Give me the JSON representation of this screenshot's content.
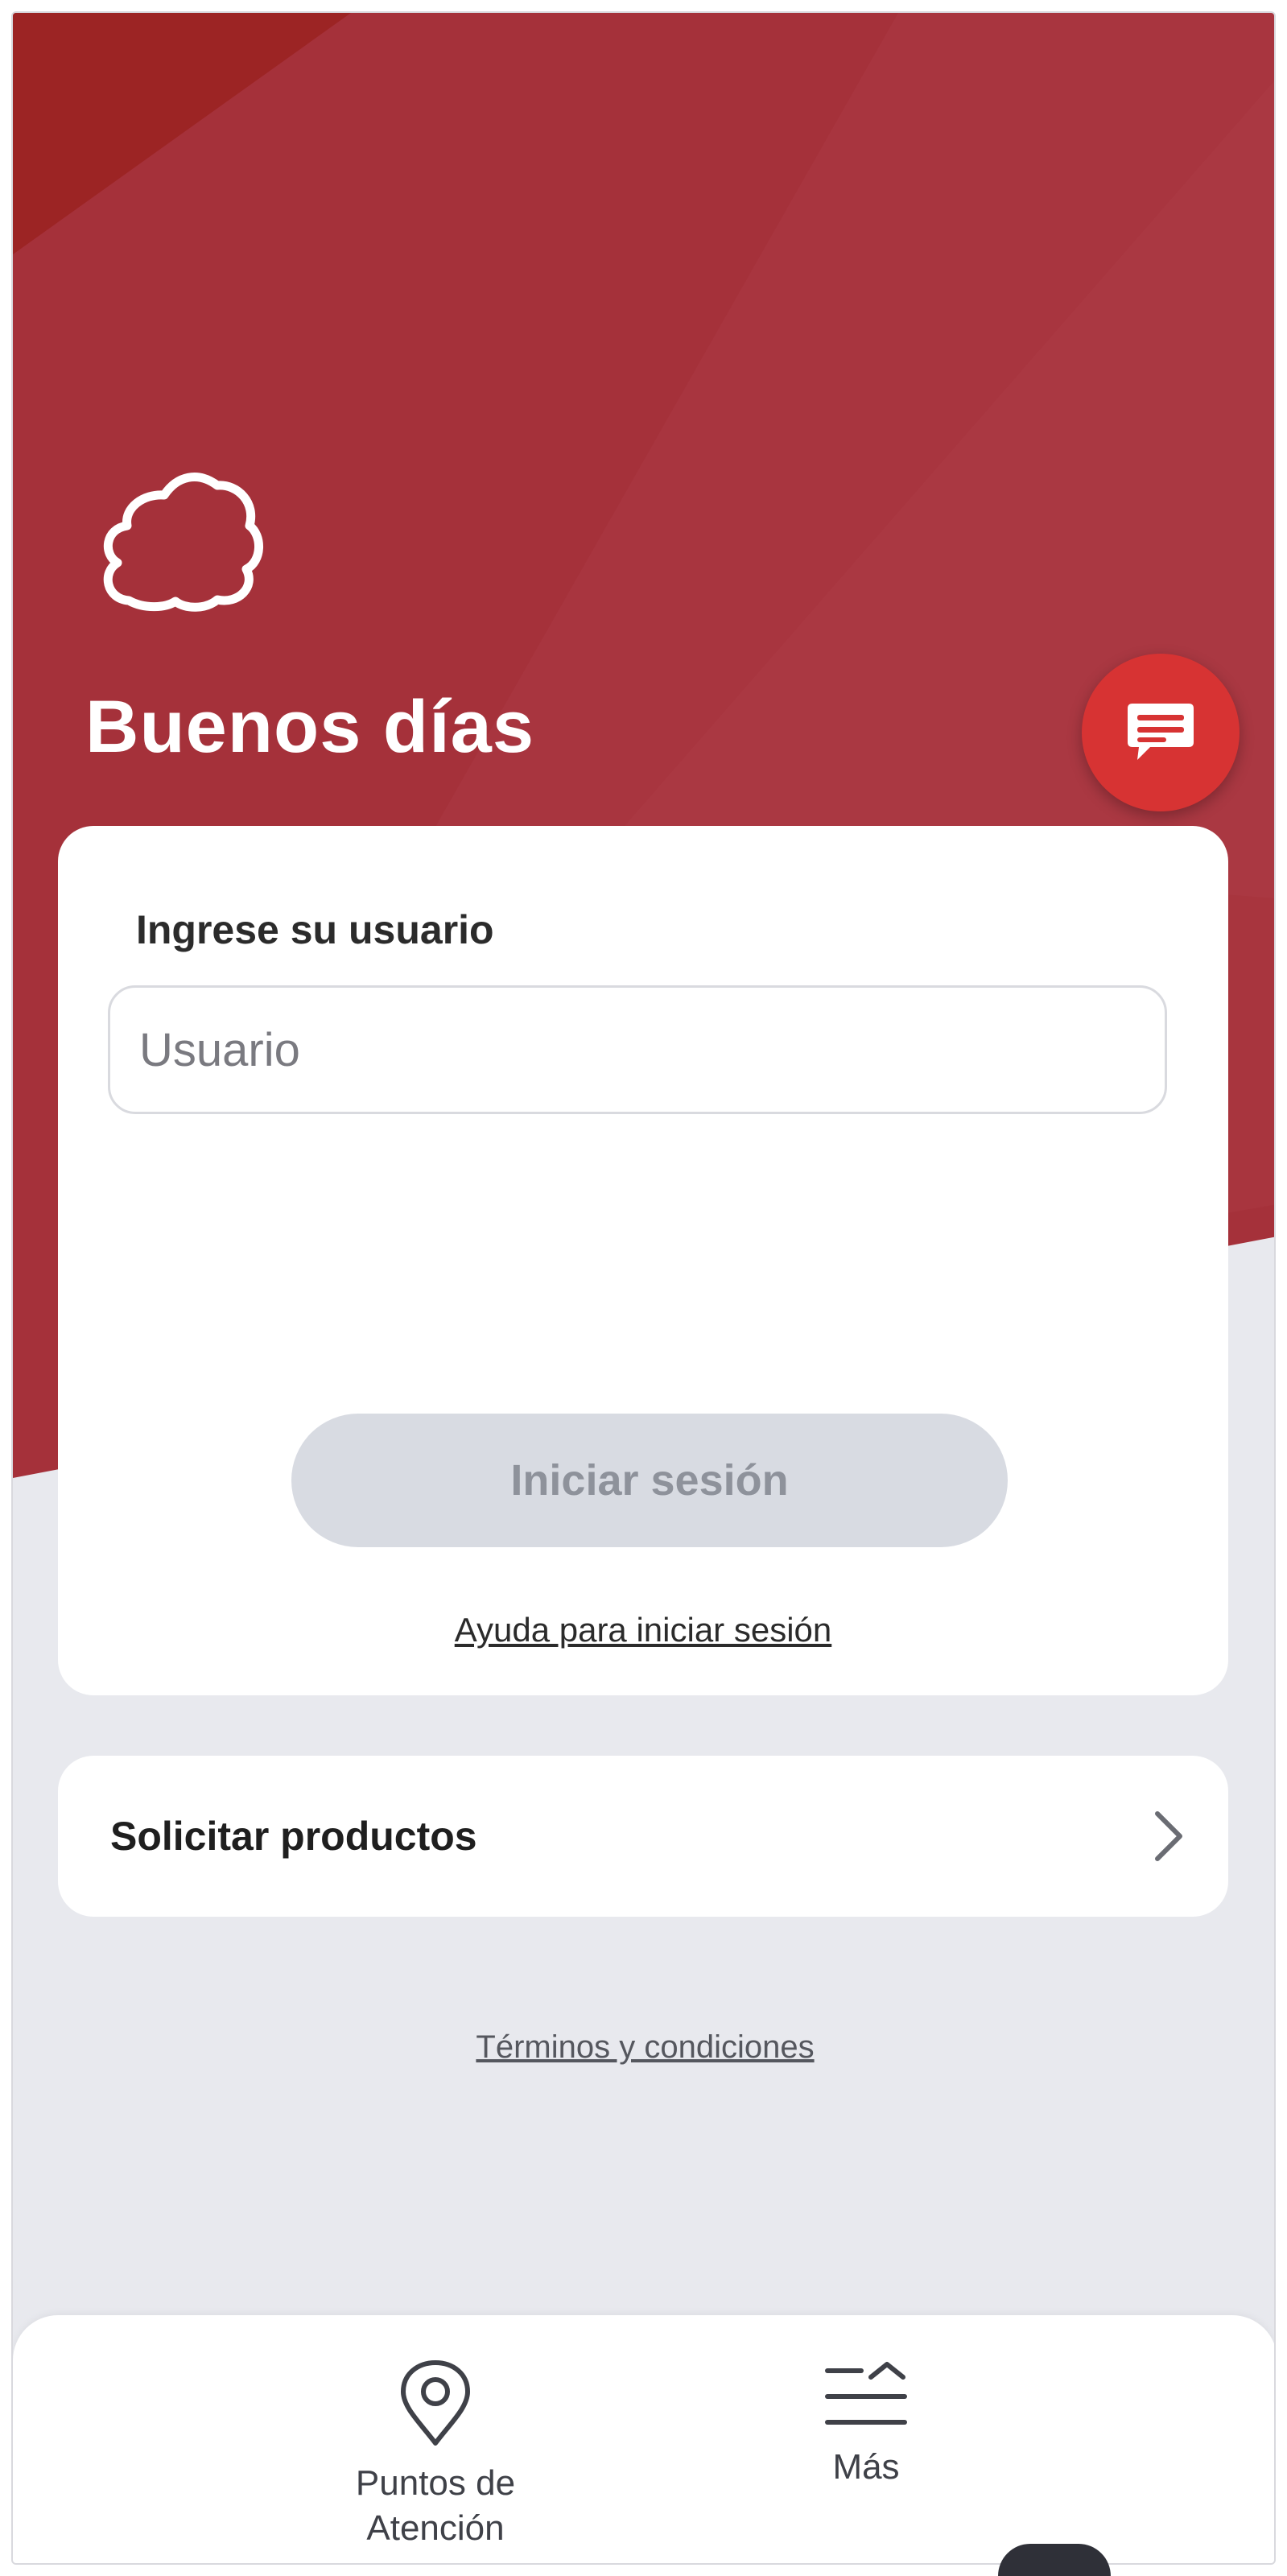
{
  "theme": {
    "brand_red": "#c0303a",
    "accent_red": "#d73333",
    "background": "#e8e9ee"
  },
  "header": {
    "logo_icon": "house-outline-icon",
    "greeting": "Buenos días"
  },
  "chat": {
    "icon": "chat-bubble-icon"
  },
  "login": {
    "label": "Ingrese su usuario",
    "username": {
      "value": "",
      "placeholder": "Usuario"
    },
    "submit_label": "Iniciar sesión",
    "submit_enabled": false,
    "help_link": "Ayuda para iniciar sesión"
  },
  "products": {
    "label": "Solicitar productos",
    "icon": "chevron-right-icon"
  },
  "terms_link": "Términos y condiciones",
  "bottom_nav": {
    "items": [
      {
        "label": "Puntos de Atención",
        "icon": "location-pin-icon"
      },
      {
        "label": "Más",
        "icon": "menu-more-icon"
      }
    ]
  }
}
